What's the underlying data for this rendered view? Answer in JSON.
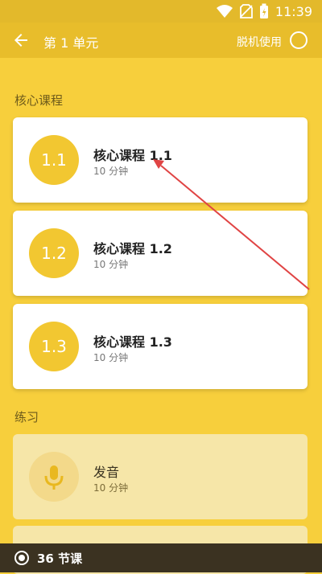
{
  "status": {
    "time": "11:39",
    "battery_label": ""
  },
  "appbar": {
    "title": "第 1 单元",
    "offline_label": "脱机使用"
  },
  "sections": [
    {
      "label": "核心课程"
    },
    {
      "label": "练习"
    }
  ],
  "core_lessons": [
    {
      "badge": "1.1",
      "title": "核心课程 1.1",
      "duration": "10 分钟"
    },
    {
      "badge": "1.2",
      "title": "核心课程 1.2",
      "duration": "10 分钟"
    },
    {
      "badge": "1.3",
      "title": "核心课程 1.3",
      "duration": "10 分钟"
    }
  ],
  "practice": [
    {
      "title": "发音",
      "duration": "10 分钟",
      "icon": "microphone-icon"
    }
  ],
  "bottom": {
    "lesson_count": "36 节课"
  },
  "colors": {
    "background": "#F7CF3C",
    "appbar": "#E8BD2B",
    "arrow": "#E04444",
    "bottom_bar": "#3B3221"
  }
}
